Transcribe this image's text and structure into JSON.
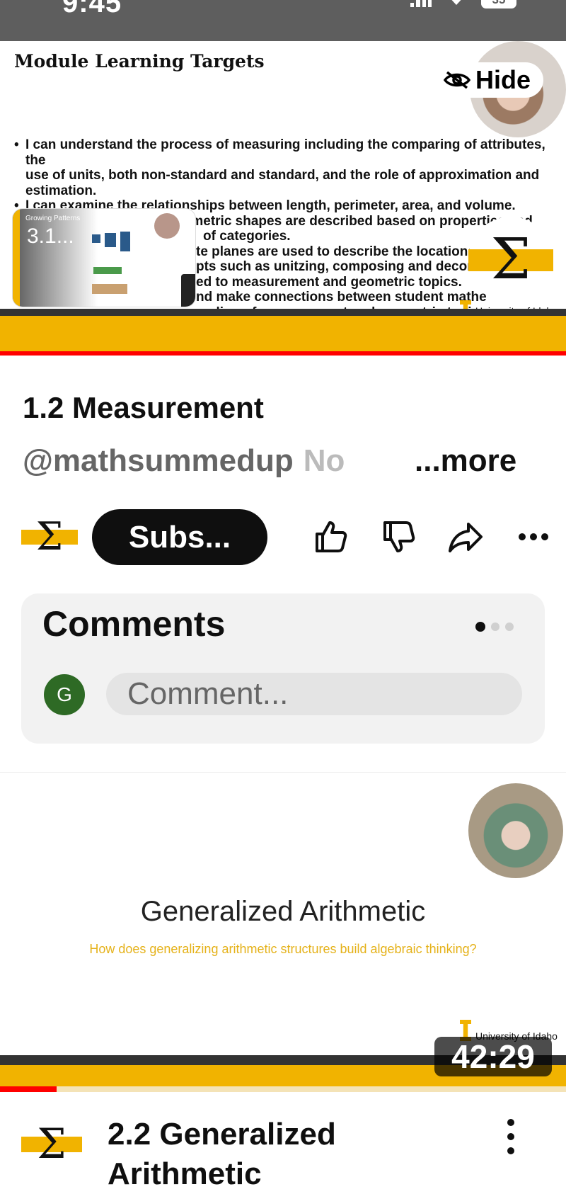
{
  "status_bar": {
    "time": "9:45",
    "battery": "35"
  },
  "player": {
    "slide_title": "Module Learning Targets",
    "hide_label": "Hide",
    "targets": [
      "I can understand the process of measuring including the comparing of attributes, the",
      "use of units, both non-standard and standard, and the role of approximation and",
      "estimation.",
      "I can examine the relationships between length, perimeter, area, and volume.",
      "I can understand how geometric shapes are described based on properties and",
      "of categories.",
      "te planes are used to describe the locations",
      "pts such as unitzing, composing and decor",
      "ed to measurement and geometric topics.",
      "nd make connections between student mathe",
      "anding of measurement and geometric topics."
    ],
    "pip_small_label": "Growing Patterns",
    "pip_label": "3.1...",
    "university": "University of Idaho",
    "accent": "#f1b300"
  },
  "info": {
    "video_title": "1.2 Measurement",
    "channel_handle": "@mathsummedup",
    "channel_handle_faded": "No",
    "more_label": "...more",
    "subscribe_label": "Subs...",
    "icons": [
      "like-icon",
      "dislike-icon",
      "share-icon",
      "more-horizontal-icon"
    ]
  },
  "comments": {
    "title": "Comments",
    "user_initial": "G",
    "placeholder": "Comment..."
  },
  "next_video": {
    "thumb_title": "Generalized Arithmetic",
    "thumb_subtitle": "How does generalizing arithmetic structures build algebraic thinking?",
    "thumb_university": "University of Idaho",
    "duration": "42:29",
    "watched_fraction": 0.1,
    "title": "2.2 Generalized Arithmetic"
  }
}
